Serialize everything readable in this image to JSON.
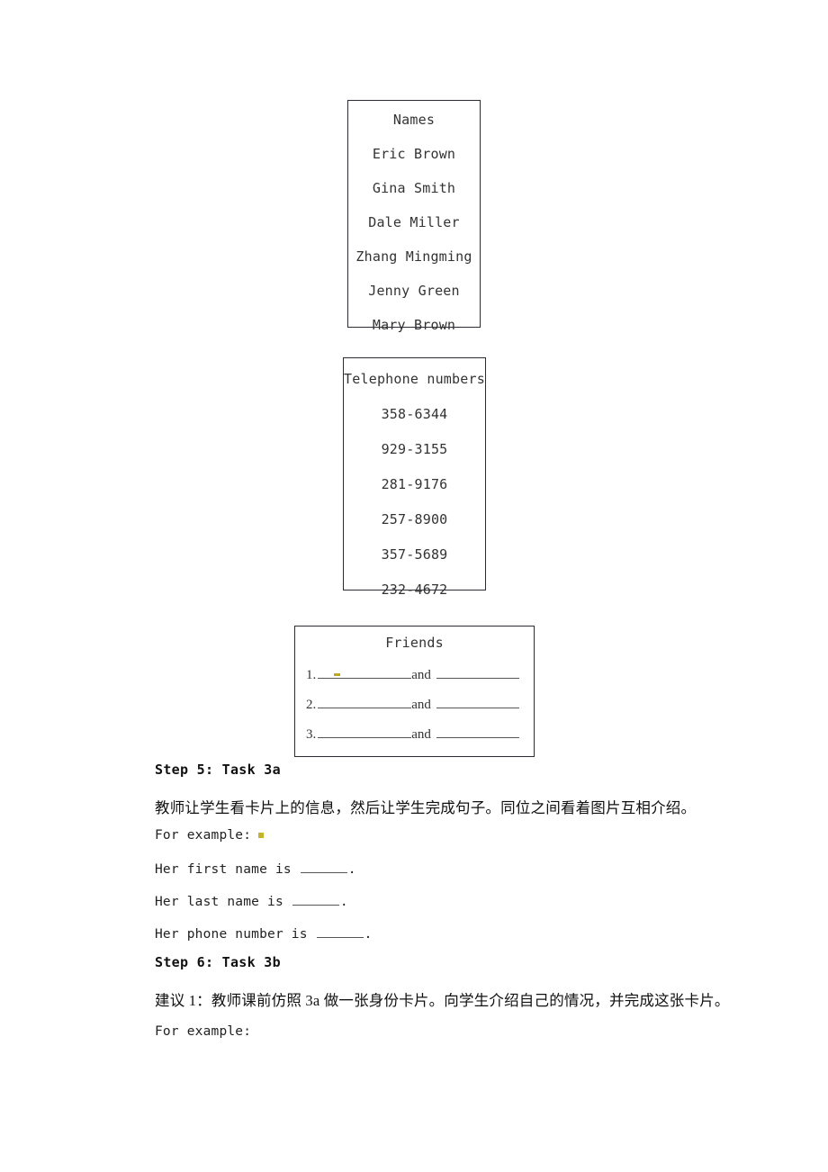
{
  "document": {
    "names_card": {
      "title": "Names",
      "entries": [
        "Eric Brown",
        "Gina Smith",
        "Dale Miller",
        "Zhang Mingming",
        "Jenny Green",
        "Mary Brown"
      ]
    },
    "phone_card": {
      "title": "Telephone numbers",
      "entries": [
        "358-6344",
        "929-3155",
        "281-9176",
        "257-8900",
        "357-5689",
        "232-4672"
      ]
    },
    "friends_card": {
      "title": "Friends",
      "rows": [
        {
          "number": "1.",
          "connector": "and"
        },
        {
          "number": "2.",
          "connector": "and"
        },
        {
          "number": "3.",
          "connector": "and"
        }
      ]
    },
    "sections": [
      {
        "heading": "Step 5: Task 3a",
        "chinese": "教师让学生看卡片上的信息，然后让学生完成句子。同位之间看着图片互相介绍。",
        "example_label": "For example:",
        "sentences": [
          {
            "before": "Her first name is ",
            "after": "."
          },
          {
            "before": "Her last name is ",
            "after": "."
          },
          {
            "before": "Her phone number is ",
            "after": "."
          }
        ]
      },
      {
        "heading": "Step 6: Task 3b",
        "chinese": "建议 1：教师课前仿照 3a 做一张身份卡片。向学生介绍自己的情况，并完成这张卡片。",
        "example_label": "For example:"
      }
    ],
    "colors": {
      "highlight_mark": "#c2b52a",
      "border": "#2b2b33",
      "text": "#222222"
    }
  }
}
